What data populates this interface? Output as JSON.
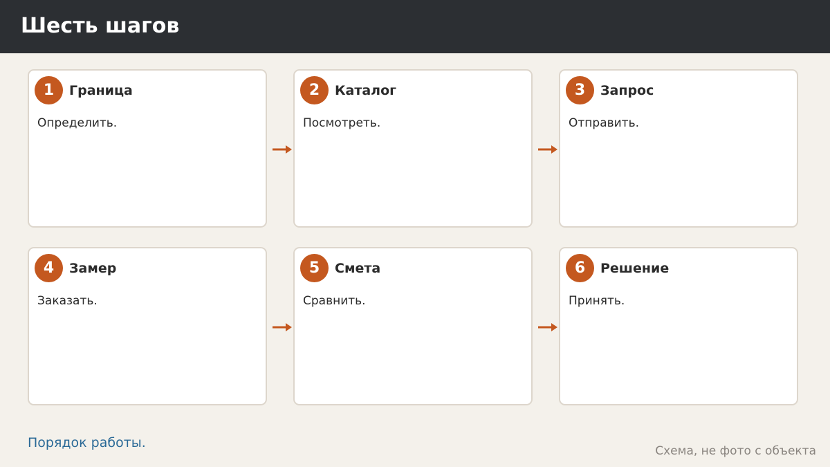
{
  "header": {
    "title": "Шесть шагов"
  },
  "steps": [
    {
      "number": "1",
      "title": "Граница",
      "description": "Определить."
    },
    {
      "number": "2",
      "title": "Каталог",
      "description": "Посмотреть."
    },
    {
      "number": "3",
      "title": "Запрос",
      "description": "Отправить."
    },
    {
      "number": "4",
      "title": "Замер",
      "description": "Заказать."
    },
    {
      "number": "5",
      "title": "Смета",
      "description": "Сравнить."
    },
    {
      "number": "6",
      "title": "Решение",
      "description": "Принять."
    }
  ],
  "footer": {
    "link": "Порядок работы.",
    "note": "Схема, не фото с объекта"
  },
  "colors": {
    "header_bg": "#2c2f33",
    "accent": "#c4581f",
    "page_bg": "#f4f1eb",
    "link": "#2b6a97"
  },
  "icons": {
    "connector": "arrow-right-icon"
  }
}
